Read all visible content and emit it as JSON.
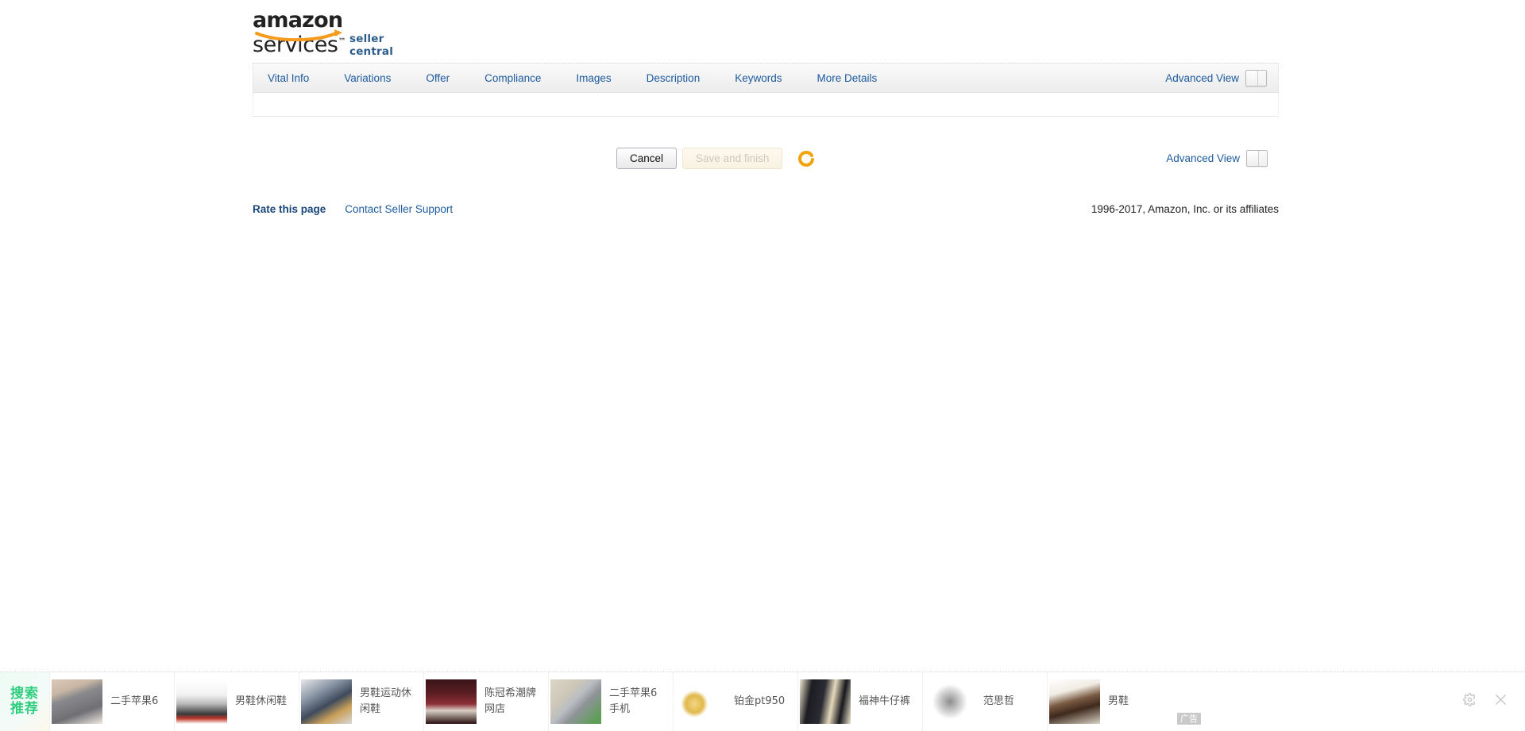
{
  "brand": {
    "logo_main": "amazon",
    "logo_services": "services",
    "logo_tm": "™",
    "logo_sub": "seller central"
  },
  "tabs": [
    {
      "label": "Vital Info"
    },
    {
      "label": "Variations"
    },
    {
      "label": "Offer"
    },
    {
      "label": "Compliance"
    },
    {
      "label": "Images"
    },
    {
      "label": "Description"
    },
    {
      "label": "Keywords"
    },
    {
      "label": "More Details"
    }
  ],
  "advanced_view": {
    "label": "Advanced View",
    "state": "off"
  },
  "actions": {
    "cancel_label": "Cancel",
    "save_label": "Save and finish",
    "save_disabled": true,
    "spinner": "loading-spinner",
    "spinner_color": "#f0a30a"
  },
  "footer": {
    "rate_link": "Rate this page",
    "support_link": "Contact Seller Support",
    "copyright": "1996-2017, Amazon, Inc. or its affiliates"
  },
  "adbar": {
    "brand_line1": "搜索",
    "brand_line2": "推荐",
    "ad_badge": "广告",
    "items": [
      {
        "label": "二手苹果6",
        "thumb": "th-phone1"
      },
      {
        "label": "男鞋休闲鞋",
        "thumb": "th-shoe1"
      },
      {
        "label": "男鞋运动休闲鞋",
        "thumb": "th-shoe2"
      },
      {
        "label": "陈冠希潮牌网店",
        "thumb": "th-person"
      },
      {
        "label": "二手苹果6手机",
        "thumb": "th-phone2"
      },
      {
        "label": "铂金pt950",
        "thumb": "th-rings"
      },
      {
        "label": "福神牛仔裤",
        "thumb": "th-jeans"
      },
      {
        "label": "范思哲",
        "thumb": "th-versace"
      },
      {
        "label": "男鞋",
        "thumb": "th-shoe3"
      }
    ],
    "tools": [
      {
        "name": "settings-gear-icon"
      },
      {
        "name": "close-icon"
      }
    ]
  },
  "colors": {
    "link_blue": "#1d5a9e",
    "strong_blue": "#18467d",
    "brand_green": "#2fce7f",
    "spinner_orange": "#f0a30a"
  }
}
